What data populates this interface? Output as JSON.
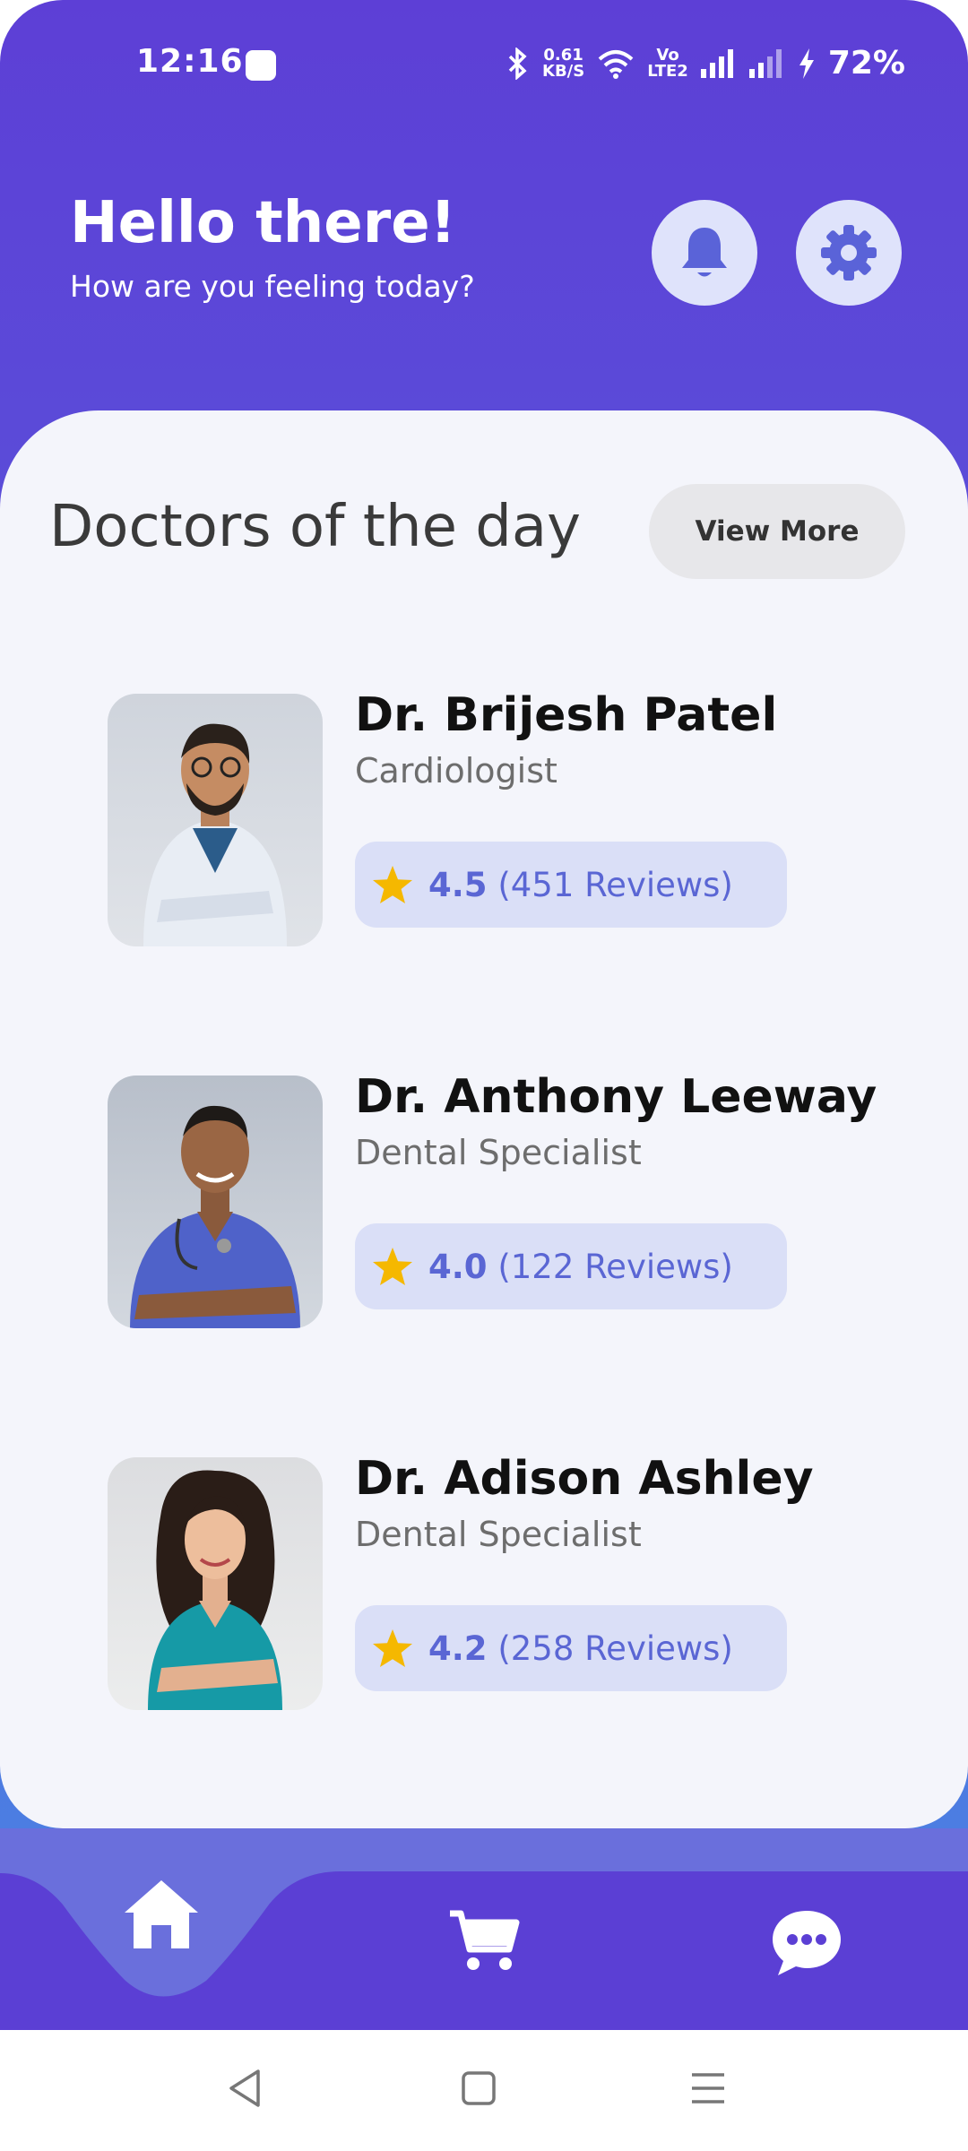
{
  "status_bar": {
    "time": "12:16",
    "net_speed_top": "0.61",
    "net_speed_bottom": "KB/S",
    "volte_top": "Vo",
    "volte_bottom": "LTE2",
    "battery": "72%"
  },
  "header": {
    "greeting": "Hello there!",
    "subtitle": "How are you feeling today?",
    "icons": [
      "bell-icon",
      "gear-icon"
    ]
  },
  "section": {
    "title": "Doctors of the day",
    "view_more": "View More"
  },
  "doctors": [
    {
      "name": "Dr. Brijesh Patel",
      "specialty": "Cardiologist",
      "rating": "4.5",
      "reviews": "(451 Reviews)",
      "scrub_color": "#e8edf4"
    },
    {
      "name": "Dr. Anthony Leeway",
      "specialty": "Dental Specialist",
      "rating": "4.0",
      "reviews": "(122 Reviews)",
      "scrub_color": "#4f62c9"
    },
    {
      "name": "Dr. Adison Ashley",
      "specialty": "Dental Specialist",
      "rating": "4.2",
      "reviews": "(258 Reviews)",
      "scrub_color": "#169aa6"
    }
  ],
  "bottom_nav": {
    "items": [
      "home-icon",
      "cart-icon",
      "chat-icon"
    ],
    "active": "home-icon"
  },
  "colors": {
    "primary": "#5a3fd6",
    "rating_text": "#5a66d4",
    "star": "#f5b800"
  }
}
